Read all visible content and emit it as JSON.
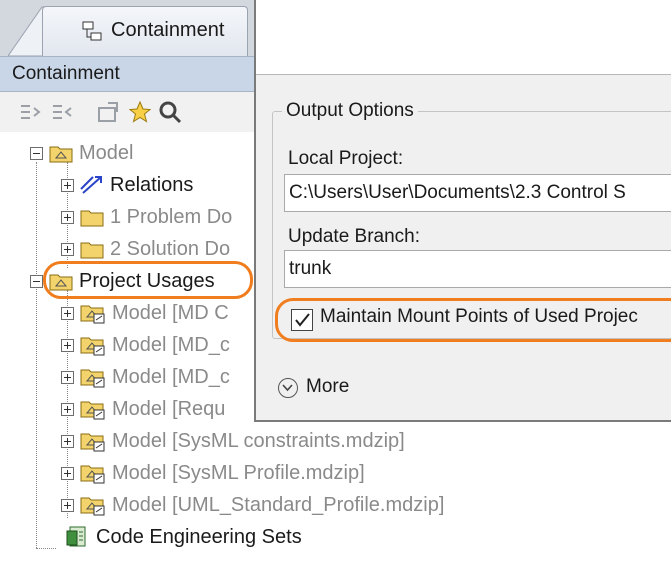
{
  "panel": {
    "tab_label": "Containment",
    "title": "Containment",
    "toolbar_icons": [
      "expand-all-icon",
      "collapse-all-icon",
      "open-icon",
      "star-icon",
      "search-icon"
    ]
  },
  "tree": {
    "root_label": "Model",
    "items": [
      {
        "label": "Relations"
      },
      {
        "label": "1 Problem Do"
      },
      {
        "label": "2 Solution Do"
      }
    ],
    "project_usages_label": "Project Usages",
    "usages": [
      {
        "label": "Model [MD C"
      },
      {
        "label": "Model [MD_c"
      },
      {
        "label": "Model [MD_c"
      },
      {
        "label": "Model [Requ"
      },
      {
        "label": "Model [SysML constraints.mdzip]"
      },
      {
        "label": "Model [SysML Profile.mdzip]"
      },
      {
        "label": "Model [UML_Standard_Profile.mdzip]"
      }
    ],
    "code_sets_label": "Code Engineering Sets"
  },
  "dialog": {
    "group_title": "Output Options",
    "local_project_label": "Local Project:",
    "local_project_value": "C:\\Users\\User\\Documents\\2.3 Control S",
    "update_branch_label": "Update Branch:",
    "update_branch_value": "trunk",
    "maintain_label": "Maintain Mount Points of Used Projec",
    "maintain_checked": true,
    "more_label": "More"
  },
  "colors": {
    "highlight": "#f07d1e",
    "title_bar": "#c9d6e8",
    "package_yellow": "#f3d36b"
  }
}
